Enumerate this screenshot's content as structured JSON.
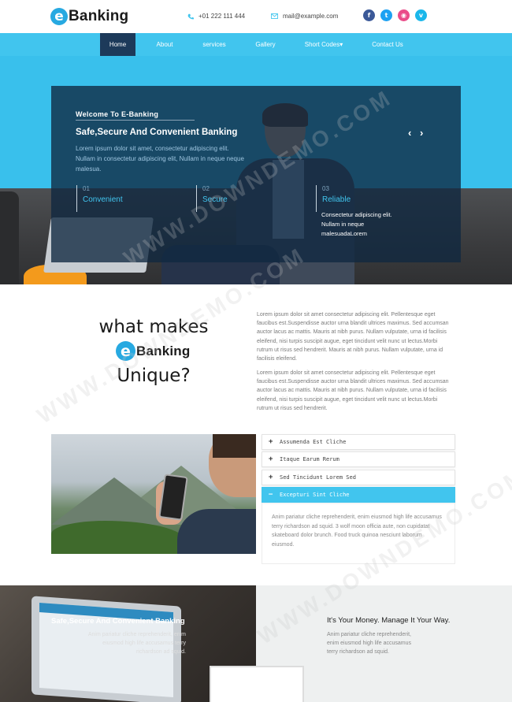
{
  "brand": {
    "logo_letter": "e",
    "logo_text": "Banking"
  },
  "contact": {
    "phone": "+01 222 111 444",
    "email": "mail@example.com"
  },
  "socials": [
    {
      "icon": "facebook-icon",
      "glyph": "f"
    },
    {
      "icon": "twitter-icon",
      "glyph": "t"
    },
    {
      "icon": "dribbble-icon",
      "glyph": "◉"
    },
    {
      "icon": "vimeo-icon",
      "glyph": "v"
    }
  ],
  "nav": {
    "items": [
      {
        "label": "Home",
        "active": true
      },
      {
        "label": "About"
      },
      {
        "label": "services"
      },
      {
        "label": "Gallery"
      },
      {
        "label": "Short Codes▾"
      },
      {
        "label": "Contact Us"
      }
    ]
  },
  "hero": {
    "welcome": "Welcome To E-Banking",
    "title": "Safe,Secure And Convenient Banking",
    "desc": "Lorem ipsum dolor sit amet, consectetur adipiscing elit. Nullam in consectetur adipiscing elit, Nullam in neque neque malesua.",
    "prev": "‹",
    "next": "›",
    "features": [
      {
        "num": "01",
        "label": "Convenient"
      },
      {
        "num": "02",
        "label": "Secure"
      },
      {
        "num": "03",
        "label": "Reliable"
      }
    ],
    "feature3_desc": "Consectetur adipiscing elit. Nullam in neque malesuadaLorem"
  },
  "unique": {
    "line1": "what makes",
    "logo_letter": "e",
    "logo_text": "Banking",
    "line3": "Unique?",
    "para1": "Lorem ipsum dolor sit amet consectetur adipiscing elit. Pellentesque eget faucibus est.Suspendisse auctor urna blandit ultrices maximus. Sed accumsan auctor lacus ac mattis. Mauris at nibh purus. Nullam vulputate, urna id facilisis eleifend, nisi turpis suscipit augue, eget tincidunt velit nunc ut lectus.Morbi rutrum ut risus sed hendrerit. Mauris at nibh purus. Nullam vulputate, urna id facilisis eleifend.",
    "para2": "Lorem ipsum dolor sit amet consectetur adipiscing elit. Pellentesque eget faucibus est.Suspendisse auctor urna blandit ultrices maximus. Sed accumsan auctor lacus ac mattis. Mauris at nibh purus. Nullam vulputate, urna id facilisis eleifend, nisi turpis suscipit augue, eget tincidunt velit nunc ut lectus.Morbi rutrum ut risus sed hendrerit."
  },
  "accordion": {
    "items": [
      {
        "label": "Assumenda Est Cliche",
        "open": false
      },
      {
        "label": "Itaque Earum Rerum",
        "open": false
      },
      {
        "label": "Sed Tincidunt Lorem Sed",
        "open": false
      },
      {
        "label": "Excepturi Sint Cliche",
        "open": true
      }
    ],
    "body": "Anim pariatur cliche reprehenderit, enim eiusmod high life accusamus terry richardson ad squid. 3 wolf moon officia aute, non cupidatat skateboard dolor brunch. Food truck quinoa nesciunt laborum eiusmod."
  },
  "bottom": {
    "left_title": "Safe,Secure And Convenient Banking",
    "left_desc": "Anim pariatur cliche reprehenderit, enim eiusmod high life accusamus terry richardson ad squid.",
    "right_title": "It's Your Money. Manage It Your Way.",
    "right_desc": "Anim pariatur cliche reprehenderit, enim eiusmod high life accusamus terry richardson ad squid."
  },
  "watermark": "WWW.DOWNDEMO.COM",
  "colors": {
    "accent": "#41c5ee",
    "nav_active": "#1d3a5a",
    "panel": "#102840"
  }
}
